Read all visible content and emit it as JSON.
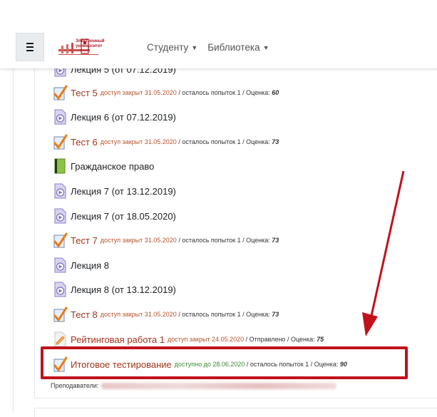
{
  "navbar": {
    "logo_line1": "Электронный",
    "logo_line2": "университет",
    "menu": [
      {
        "label": "Студенту"
      },
      {
        "label": "Библиотека"
      }
    ]
  },
  "activities": [
    {
      "type": "lecture",
      "name": "Лекция 5 (от 07.12.2019)"
    },
    {
      "type": "test",
      "name": "Тест 5",
      "availability": "доступ закрыт 31.05.2020",
      "info": " / осталось попыток 1 / Оценка: ",
      "grade": "60"
    },
    {
      "type": "lecture",
      "name": "Лекция 6 (от 07.12.2019)"
    },
    {
      "type": "test",
      "name": "Тест 6",
      "availability": "доступ закрыт 31.05.2020",
      "info": " / осталось попыток 1 / Оценка: ",
      "grade": "73"
    },
    {
      "type": "book",
      "name": "Гражданское право"
    },
    {
      "type": "lecture",
      "name": "Лекция 7 (от 13.12.2019)"
    },
    {
      "type": "lecture",
      "name": "Лекция 7 (от 18.05.2020)"
    },
    {
      "type": "test",
      "name": "Тест 7",
      "availability": "доступ закрыт 31.05.2020",
      "info": " / осталось попыток 1 / Оценка: ",
      "grade": "73"
    },
    {
      "type": "lecture",
      "name": "Лекция 8"
    },
    {
      "type": "lecture",
      "name": "Лекция 8 (от 13.12.2019)"
    },
    {
      "type": "test",
      "name": "Тест 8",
      "availability": "доступ закрыт 31.05.2020",
      "info": " / осталось попыток 1 / Оценка: ",
      "grade": "73"
    },
    {
      "type": "assignment",
      "name": "Рейтинговая работа 1",
      "availability": "доступ закрыт 24.05.2020",
      "info": " / Отправлено / Оценка: ",
      "grade": "75"
    },
    {
      "type": "test",
      "name": "Итоговое тестирование",
      "availability": "доступно до 28.06.2020",
      "info": " / осталось попыток 1 / Оценка: ",
      "grade": "90"
    }
  ],
  "teachers_label": "Преподаватели:",
  "colors": {
    "highlight": "#c1121b",
    "arrow": "#c1121b",
    "test_name": "#a2331b",
    "availability_closed": "#b5532d",
    "availability_open": "#3a8b2f"
  }
}
